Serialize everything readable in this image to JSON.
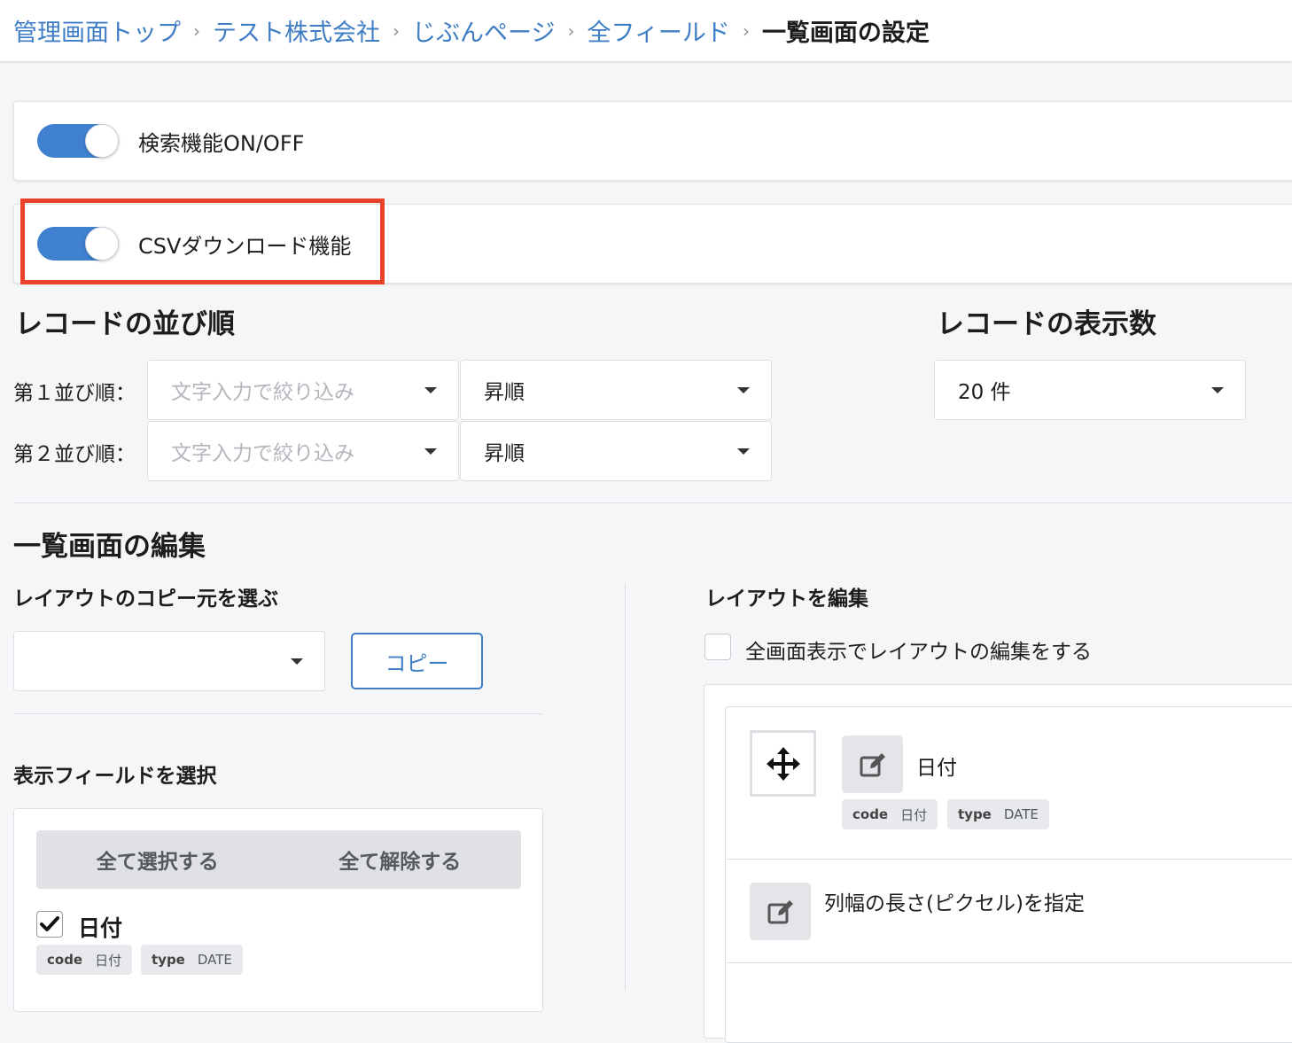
{
  "breadcrumb": {
    "items": [
      "管理画面トップ",
      "テスト株式会社",
      "じぶんページ",
      "全フィールド"
    ],
    "current": "一覧画面の設定",
    "separator": "›"
  },
  "toggles": {
    "search": {
      "label": "検索機能ON/OFF",
      "on": true
    },
    "csv": {
      "label": "CSVダウンロード機能",
      "on": true
    }
  },
  "sort": {
    "title": "レコードの並び順",
    "rows": [
      {
        "label": "第１並び順：",
        "field_placeholder": "文字入力で絞り込み",
        "order": "昇順"
      },
      {
        "label": "第２並び順：",
        "field_placeholder": "文字入力で絞り込み",
        "order": "昇順"
      }
    ]
  },
  "count": {
    "title": "レコードの表示数",
    "value": "20 件"
  },
  "edit": {
    "title": "一覧画面の編集",
    "copy_source_title": "レイアウトのコピー元を選ぶ",
    "copy_source_value": "",
    "copy_button": "コピー",
    "layout_title": "レイアウトを編集",
    "fullscreen_label": "全画面表示でレイアウトの編集をする",
    "fields_title": "表示フィールドを選択",
    "select_all": "全て選択する",
    "deselect_all": "全て解除する",
    "field_list": [
      {
        "name": "日付",
        "code_key": "code",
        "code": "日付",
        "type_key": "type",
        "type": "DATE",
        "checked": true
      }
    ],
    "layout_items": [
      {
        "name": "日付",
        "code_key": "code",
        "code": "日付",
        "type_key": "type",
        "type": "DATE"
      }
    ],
    "column_width_label": "列幅の長さ(ピクセル)を指定"
  },
  "colors": {
    "accent": "#3f80cf",
    "highlight": "#e8412c",
    "link": "#3f7dc4"
  },
  "icons": [
    "chevron-right-icon",
    "caret-down-icon",
    "move-icon",
    "edit-icon",
    "check-icon"
  ]
}
